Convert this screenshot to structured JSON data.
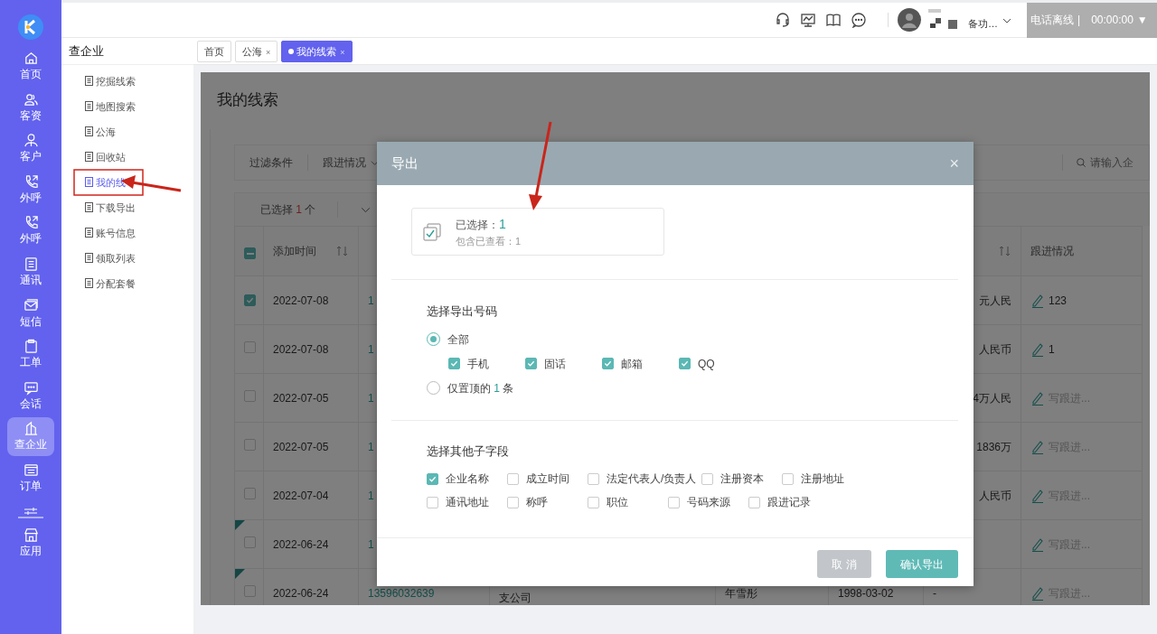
{
  "app_nav": [
    {
      "label": "首页",
      "selected": false
    },
    {
      "label": "客资",
      "selected": false
    },
    {
      "label": "客户",
      "selected": false
    },
    {
      "label": "外呼",
      "selected": false
    },
    {
      "label": "外呼",
      "selected": false
    },
    {
      "label": "通讯",
      "selected": false
    },
    {
      "label": "短信",
      "selected": false
    },
    {
      "label": "工单",
      "selected": false
    },
    {
      "label": "会话",
      "selected": false
    },
    {
      "label": "查企业",
      "selected": true
    },
    {
      "label": "订单",
      "selected": false
    },
    {
      "label": "应用",
      "selected": false
    }
  ],
  "header": {
    "user_note": "备功…",
    "line_status": "电话离线",
    "separator": "|",
    "timer": "00:00:00",
    "timer_caret": "▼"
  },
  "module": {
    "title": "查企业",
    "items": [
      {
        "label": "挖掘线索",
        "selected": false
      },
      {
        "label": "地图搜索",
        "selected": false
      },
      {
        "label": "公海",
        "selected": false
      },
      {
        "label": "回收站",
        "selected": false
      },
      {
        "label": "我的线",
        "selected": true
      },
      {
        "label": "下载导出",
        "selected": false
      },
      {
        "label": "账号信息",
        "selected": false
      },
      {
        "label": "领取列表",
        "selected": false
      },
      {
        "label": "分配套餐",
        "selected": false
      }
    ]
  },
  "tabs": [
    {
      "label": "首页",
      "selected": false
    },
    {
      "label": "公海",
      "close": "×",
      "selected": false
    },
    {
      "label": "我的线索",
      "close": "×",
      "selected": true
    }
  ],
  "page_title": "我的线索",
  "filter_bar": {
    "label": "过滤条件",
    "dropdown": "跟进情况",
    "search_placeholder": "请输入企"
  },
  "selection_bar": {
    "prefix": "已选择",
    "count": "1",
    "suffix": "个"
  },
  "table": {
    "columns": [
      {
        "label": "添加时间",
        "sortable": true
      },
      {
        "label": "跟进情况",
        "sortable": false
      }
    ],
    "indeterminate": true,
    "rows": [
      {
        "checked": true,
        "date": "2022-07-08",
        "phone": "1",
        "capital": "元人民",
        "followup": "123",
        "kind": "note",
        "flagged": false
      },
      {
        "checked": false,
        "date": "2022-07-08",
        "phone": "1",
        "capital": "人民币",
        "followup": "1",
        "kind": "note",
        "flagged": false
      },
      {
        "checked": false,
        "date": "2022-07-05",
        "phone": "1",
        "capital": "4万人民",
        "followup": "写跟进...",
        "kind": "prompt",
        "flagged": false
      },
      {
        "checked": false,
        "date": "2022-07-05",
        "phone": "1",
        "capital": "1836万",
        "followup": "写跟进...",
        "kind": "prompt",
        "flagged": false
      },
      {
        "checked": false,
        "date": "2022-07-04",
        "phone": "1",
        "capital": "人民币",
        "followup": "写跟进...",
        "kind": "prompt",
        "flagged": false
      },
      {
        "checked": false,
        "date": "2022-06-24",
        "phone": "1",
        "followup": "写跟进...",
        "kind": "prompt",
        "flagged": true
      },
      {
        "checked": false,
        "date": "2022-06-24",
        "phone": "13596032639",
        "company": "支公司",
        "contact": "年雪彤",
        "founded": "1998-03-02",
        "capital": "-",
        "followup": "写跟进...",
        "kind": "prompt",
        "flagged": true
      }
    ]
  },
  "dialog": {
    "title": "导出",
    "close": "×",
    "summary": {
      "selected_label": "已选择：",
      "selected_count": "1",
      "viewed_label": "包含已查看：",
      "viewed_count": "1"
    },
    "number_section": {
      "title": "选择导出号码",
      "all_option": {
        "label": "全部",
        "selected": true
      },
      "number_types": [
        {
          "label": "手机",
          "checked": true
        },
        {
          "label": "固话",
          "checked": true
        },
        {
          "label": "邮箱",
          "checked": true
        },
        {
          "label": "QQ",
          "checked": true
        }
      ],
      "top_option": {
        "prefix": "仅置顶的",
        "count": "1",
        "suffix": "条",
        "selected": false
      }
    },
    "field_section": {
      "title": "选择其他子字段",
      "rows": [
        [
          {
            "label": "企业名称",
            "checked": true
          },
          {
            "label": "成立时间",
            "checked": false
          },
          {
            "label": "法定代表人/负责人",
            "checked": false
          },
          {
            "label": "注册资本",
            "checked": false
          },
          {
            "label": "注册地址",
            "checked": false
          }
        ],
        [
          {
            "label": "通讯地址",
            "checked": false
          },
          {
            "label": "称呼",
            "checked": false
          },
          {
            "label": "职位",
            "checked": false
          },
          {
            "label": "号码来源",
            "checked": false
          },
          {
            "label": "跟进记录",
            "checked": false
          }
        ]
      ]
    },
    "buttons": [
      {
        "label": "取 消",
        "kind": "secondary"
      },
      {
        "label": "确认导出",
        "kind": "primary"
      }
    ]
  }
}
